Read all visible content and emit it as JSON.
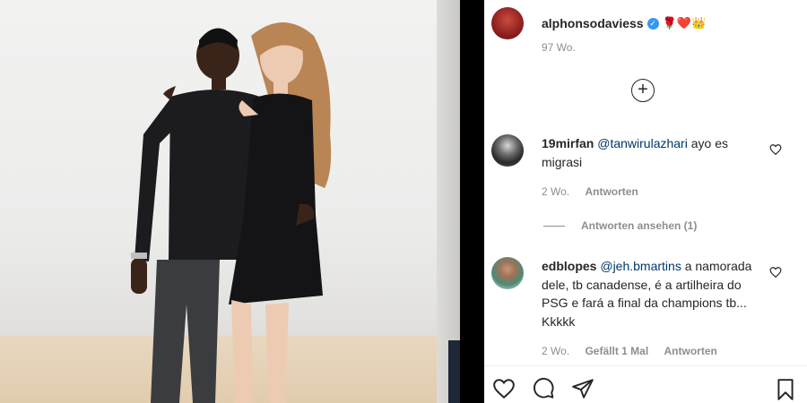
{
  "post": {
    "username": "alphonsodaviess",
    "emojis": "🌹❤️👑",
    "time_ago": "97 Wo."
  },
  "comments": [
    {
      "username": "19mirfan",
      "mention": "@tanwirulazhari",
      "text": " ayo es migrasi",
      "time_ago": "2 Wo.",
      "reply_label": "Antworten",
      "view_replies": "Antworten ansehen (1)"
    },
    {
      "username": "edblopes",
      "mention": "@jeh.bmartins",
      "text": " a namorada dele, tb canadense, é a artilheira do PSG e fará a final da champions tb... Kkkkk",
      "time_ago": "2 Wo.",
      "likes": "Gefällt 1 Mal",
      "reply_label": "Antworten"
    }
  ],
  "icons": {
    "load_more": "plus-circle-icon",
    "like": "heart-icon",
    "comment": "comment-icon",
    "share": "paper-plane-icon",
    "save": "bookmark-icon"
  },
  "colors": {
    "text": "#262626",
    "secondary": "#8e8e8e",
    "verified": "#3897f0",
    "mention": "#00376b"
  }
}
